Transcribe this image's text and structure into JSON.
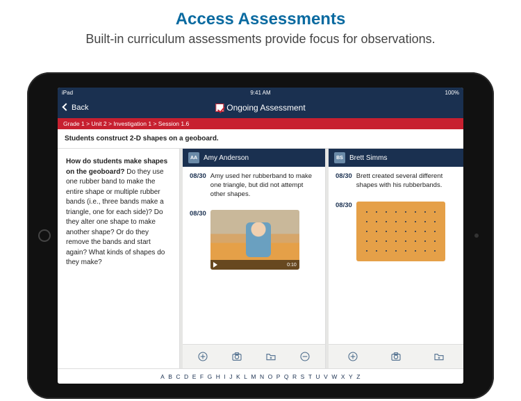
{
  "promo": {
    "title": "Access Assessments",
    "subtitle": "Built-in curriculum assessments provide focus for observations."
  },
  "status": {
    "carrier": "iPad",
    "time": "9:41 AM",
    "battery": "100%"
  },
  "nav": {
    "back": "Back",
    "title": "Ongoing Assessment"
  },
  "breadcrumb": "Grade 1 > Unit 2 > Investigation 1 > Session 1.6",
  "task": "Students construct 2-D shapes on a geoboard.",
  "question": {
    "lead": "How do students make shapes on the geoboard?",
    "body": " Do they use one rubber band to make the entire shape or multiple rubber bands (i.e., three bands make a triangle, one for each side)? Do they alter one shape to make another shape? Or do they remove the bands and start again? What kinds of shapes do they make?"
  },
  "students": [
    {
      "initials": "AA",
      "name": "Amy Anderson",
      "entries": [
        {
          "date": "08/30",
          "text": "Amy used her rubberband to make one triangle, but did not attempt other shapes."
        },
        {
          "date": "08/30",
          "media": "video",
          "duration": "0:10"
        }
      ]
    },
    {
      "initials": "BS",
      "name": "Brett Simms",
      "entries": [
        {
          "date": "08/30",
          "text": "Brett created several different shapes with his rubberbands."
        },
        {
          "date": "08/30",
          "media": "photo"
        }
      ]
    }
  ],
  "action_icons": [
    "add",
    "camera",
    "folder",
    "remove"
  ],
  "alphabet": [
    "A",
    "B",
    "C",
    "D",
    "E",
    "F",
    "G",
    "H",
    "I",
    "J",
    "K",
    "L",
    "M",
    "N",
    "O",
    "P",
    "Q",
    "R",
    "S",
    "T",
    "U",
    "V",
    "W",
    "X",
    "Y",
    "Z"
  ]
}
